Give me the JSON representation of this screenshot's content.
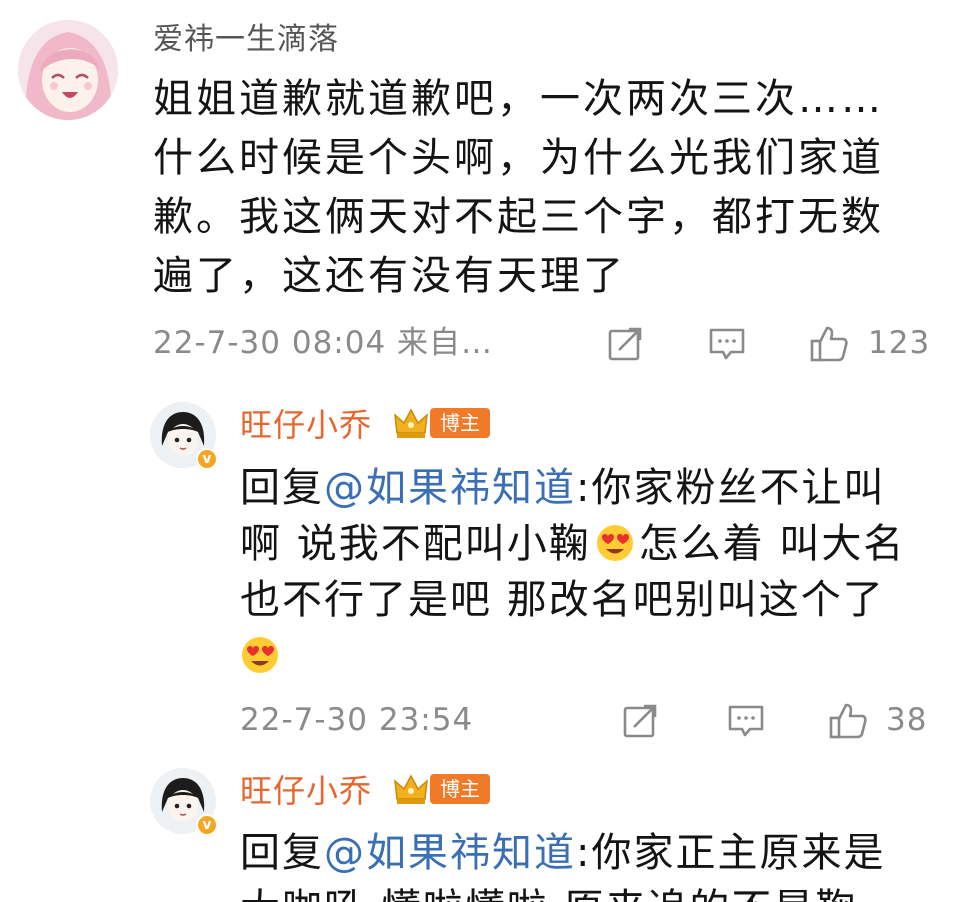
{
  "comment": {
    "username": "爱祎一生滴落",
    "body_lines": [
      "姐姐道歉就道歉吧，一次两次三次……",
      "什么时候是个头啊，为什么光我们家道",
      "歉。我这俩天对不起三个字，都打无数",
      "遍了，这还有没有天理了"
    ],
    "time": "22-7-30 08:04 来自…",
    "like_count": "123"
  },
  "replies": [
    {
      "username": "旺仔小乔",
      "tag": "博主",
      "prefix": "回复",
      "mention": "@如果祎知道",
      "line1_rest": ":你家粉丝不让叫",
      "line2_a": "啊 说我不配叫小鞠",
      "line2_b": "怎么着 叫大名",
      "line3": "也不行了是吧 那改名吧别叫这个了",
      "time": "22-7-30 23:54",
      "like_count": "38"
    },
    {
      "username": "旺仔小乔",
      "tag": "博主",
      "prefix": "回复",
      "mention": "@如果祎知道",
      "line1_rest": ":你家正主原来是",
      "line2_partial": "大咖吼 懂啦懂啦  原来追的不是鞠"
    }
  ],
  "icons": {
    "share": "share-icon",
    "comment": "comment-icon",
    "like": "thumbs-up-icon",
    "emoji": "heart-eyes-emoji",
    "crown": "crown-badge-icon",
    "verified": "verified-v-icon"
  },
  "colors": {
    "username_orange": "#e8662e",
    "mention_blue": "#3b6fb5",
    "blogger_tag": "#f07a28",
    "meta_gray": "#8a8a8a"
  }
}
